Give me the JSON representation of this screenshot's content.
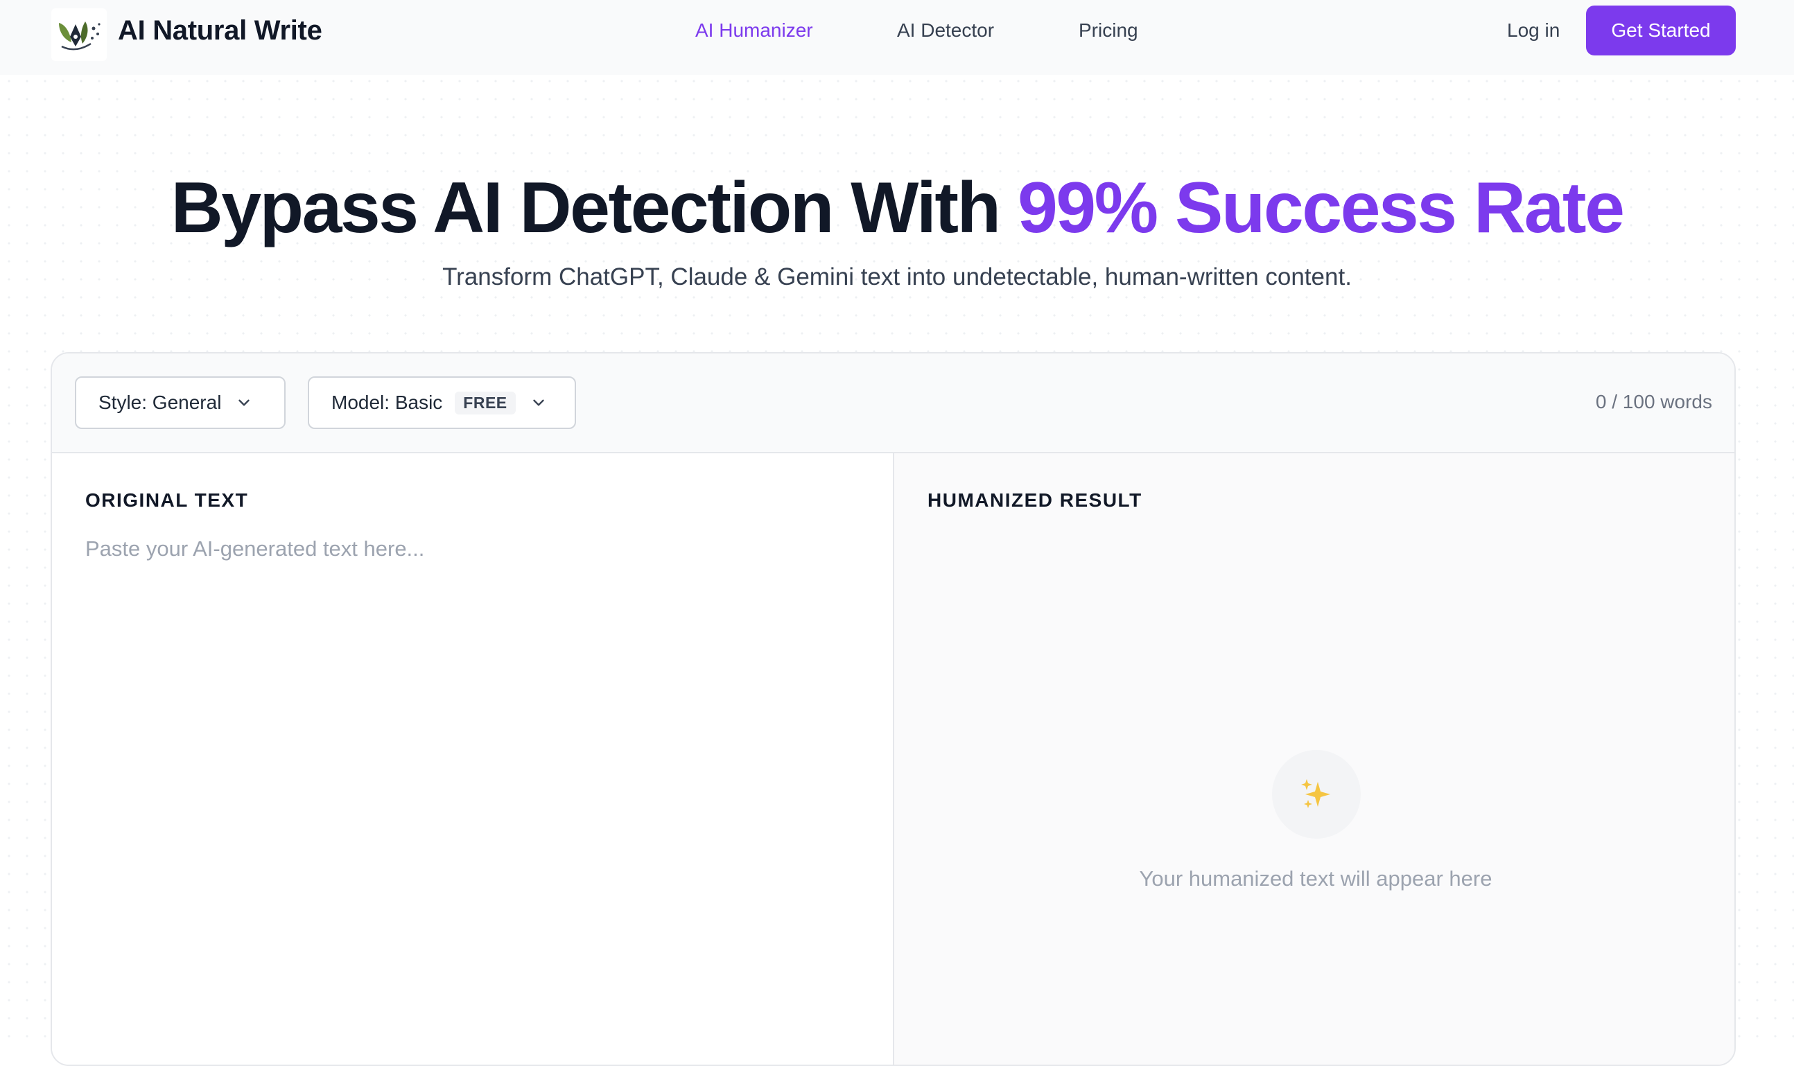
{
  "nav": {
    "brand": "AI Natural Write",
    "links": [
      {
        "label": "AI Humanizer",
        "active": true
      },
      {
        "label": "AI Detector",
        "active": false
      },
      {
        "label": "Pricing",
        "active": false
      }
    ],
    "login": "Log in",
    "cta": "Get Started"
  },
  "hero": {
    "title_main": "Bypass AI Detection With ",
    "title_accent": "99% Success Rate",
    "subtitle": "Transform ChatGPT, Claude & Gemini text into undetectable, human-written content."
  },
  "editor": {
    "style_select": "Style: General",
    "model_select": "Model: Basic",
    "model_badge": "FREE",
    "word_count": "0 / 100 words",
    "original_label": "ORIGINAL TEXT",
    "original_placeholder": "Paste your AI-generated text here...",
    "result_label": "HUMANIZED RESULT",
    "result_empty": "Your humanized text will appear here"
  },
  "colors": {
    "accent": "#7c3aed",
    "text": "#111827",
    "muted": "#9ca3af"
  },
  "icons": {
    "logo": "leaf-pen-logo-icon",
    "chevron": "chevron-down-icon",
    "empty": "sparkles-icon"
  }
}
